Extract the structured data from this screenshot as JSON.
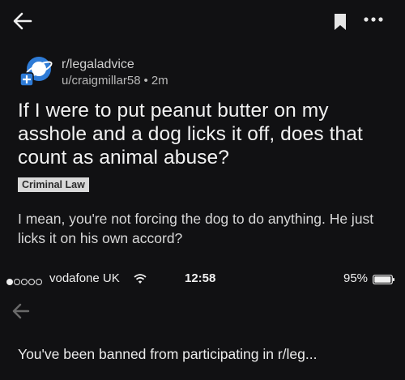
{
  "post": {
    "subreddit": "r/legaladvice",
    "author": "u/craigmillar58",
    "separator": "•",
    "age": "2m",
    "title": "If I were to put peanut butter on my asshole and a dog licks it off, does that count as animal abuse?",
    "flair": "Criminal Law",
    "body": "I mean, you're not forcing the dog to do anything. He just licks it on his own accord?"
  },
  "status_bar": {
    "carrier": "vodafone UK",
    "time": "12:58",
    "battery": "95%",
    "signal_bars": 1,
    "signal_max": 5
  },
  "notice": {
    "text": "You've been banned from participating in r/leg..."
  },
  "icons": [
    "back-arrow-icon",
    "bookmark-icon",
    "more-icon",
    "subreddit-avatar-icon",
    "wifi-icon",
    "battery-icon"
  ],
  "colors": {
    "background": "#111113",
    "accent_blue": "#2e7bd6",
    "flair_bg": "#d9d9d9"
  }
}
